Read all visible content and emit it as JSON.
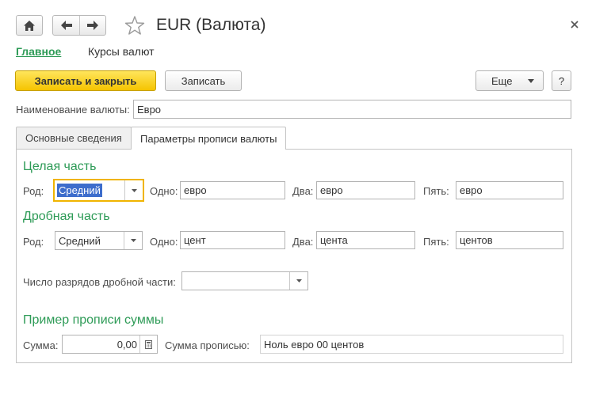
{
  "window": {
    "title": "EUR (Валюта)"
  },
  "nav": {
    "main_link": "Главное",
    "rates_link": "Курсы валют"
  },
  "toolbar": {
    "save_close_label": "Записать и закрыть",
    "save_label": "Записать",
    "more_label": "Еще",
    "help_label": "?"
  },
  "currency_name": {
    "label": "Наименование валюты:",
    "value": "Евро"
  },
  "tabs": [
    {
      "label": "Основные сведения",
      "active": false
    },
    {
      "label": "Параметры прописи валюты",
      "active": true
    }
  ],
  "integer_part": {
    "heading": "Целая часть",
    "gender_label": "Род:",
    "gender_value": "Средний",
    "one_label": "Одно:",
    "one_value": "евро",
    "two_label": "Два:",
    "two_value": "евро",
    "five_label": "Пять:",
    "five_value": "евро"
  },
  "fractional_part": {
    "heading": "Дробная часть",
    "gender_label": "Род:",
    "gender_value": "Средний",
    "one_label": "Одно:",
    "one_value": "цент",
    "two_label": "Два:",
    "two_value": "цента",
    "five_label": "Пять:",
    "five_value": "центов",
    "digits_label": "Число разрядов дробной части:",
    "digits_value": ""
  },
  "example": {
    "heading": "Пример прописи суммы",
    "sum_label": "Сумма:",
    "sum_value": "0,00",
    "words_label": "Сумма прописью:",
    "words_value": "Ноль евро 00 центов"
  },
  "colors": {
    "accent_green": "#2e9b57",
    "primary_yellow": "#f5c400",
    "focus_border": "#f0b400",
    "selection_blue": "#3d6dcc"
  }
}
